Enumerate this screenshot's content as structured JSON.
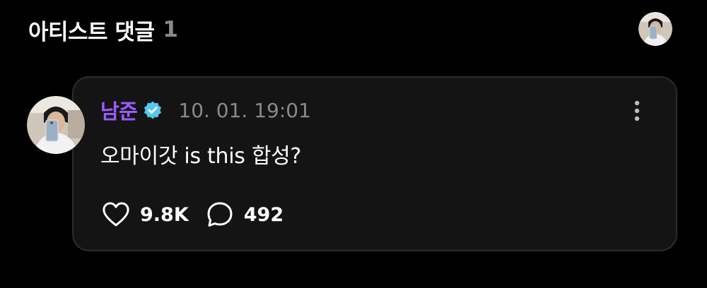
{
  "header": {
    "title": "아티스트 댓글",
    "count": "1",
    "avatar_icon": "artist-profile-photo"
  },
  "comment": {
    "author": "남준",
    "verified_icon": "verified-badge-icon",
    "timestamp": "10. 01. 19:01",
    "text": "오마이갓 is this 합성?",
    "avatar_icon": "artist-profile-photo",
    "more_icon": "more-vertical-icon",
    "likes": "9.8K",
    "replies": "492",
    "like_icon": "heart-outline-icon",
    "reply_icon": "speech-bubble-icon"
  },
  "colors": {
    "background": "#000000",
    "card_background": "#141414",
    "card_border": "#2c2c2c",
    "author_name": "#9b5cff",
    "verified_badge": "#56c7f2",
    "muted_text": "#8a8a8a",
    "primary_text": "#ffffff"
  }
}
